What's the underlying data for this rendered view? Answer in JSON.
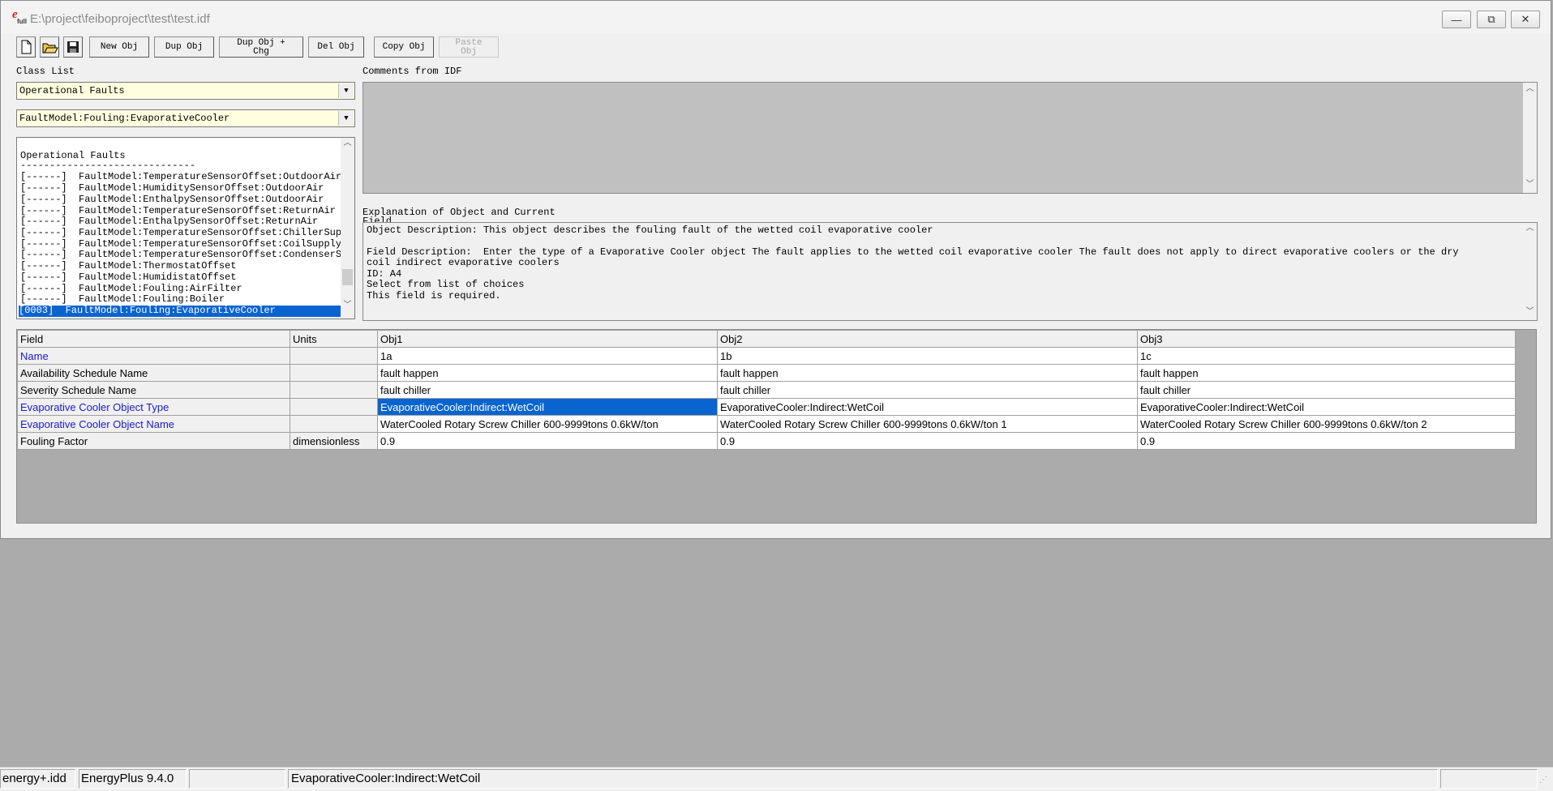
{
  "window": {
    "title": "E:\\project\\feiboproject\\test\\test.idf",
    "buttons": {
      "minimize_glyph": "▭",
      "maximize_glyph": "⧉",
      "close_glyph": "✕"
    }
  },
  "toolbar": {
    "new_obj": "New Obj",
    "dup_obj": "Dup Obj",
    "dup_obj_chg_line1": "Dup Obj +",
    "dup_obj_chg_line2": "Chg",
    "del_obj": "Del Obj",
    "copy_obj": "Copy Obj",
    "paste_obj_line1": "Paste",
    "paste_obj_line2": "Obj"
  },
  "left": {
    "class_list_label": "Class List",
    "group_dropdown": "Operational Faults",
    "class_dropdown": "FaultModel:Fouling:EvaporativeCooler",
    "list": {
      "header": "Operational Faults",
      "separator": "------------------------------",
      "items": [
        "[------]  FaultModel:TemperatureSensorOffset:OutdoorAir",
        "[------]  FaultModel:HumiditySensorOffset:OutdoorAir",
        "[------]  FaultModel:EnthalpySensorOffset:OutdoorAir",
        "[------]  FaultModel:TemperatureSensorOffset:ReturnAir",
        "[------]  FaultModel:EnthalpySensorOffset:ReturnAir",
        "[------]  FaultModel:TemperatureSensorOffset:ChillerSupplyWater",
        "[------]  FaultModel:TemperatureSensorOffset:CoilSupplyAir",
        "[------]  FaultModel:TemperatureSensorOffset:CondenserSupplyWater",
        "[------]  FaultModel:ThermostatOffset",
        "[------]  FaultModel:HumidistatOffset",
        "[------]  FaultModel:Fouling:AirFilter",
        "[------]  FaultModel:Fouling:Boiler"
      ],
      "selected": "[0003]  FaultModel:Fouling:EvaporativeCooler"
    }
  },
  "right": {
    "comments_label": "Comments from IDF",
    "explanation_label": "Explanation of Object and Current",
    "explanation_label_cut": "Field",
    "explanation_lines": [
      "Object Description: This object describes the fouling fault of the wetted coil evaporative cooler",
      "",
      "Field Description:  Enter the type of a Evaporative Cooler object The fault applies to the wetted coil evaporative cooler The fault does not apply to direct evaporative coolers or the dry",
      "coil indirect evaporative coolers",
      "ID: A4",
      "Select from list of choices",
      "This field is required."
    ]
  },
  "grid": {
    "headers": [
      "Field",
      "Units",
      "Obj1",
      "Obj2",
      "Obj3"
    ],
    "rows": [
      {
        "field": "Name",
        "units": "",
        "values": [
          "1a",
          "1b",
          "1c"
        ],
        "required": true
      },
      {
        "field": "Availability Schedule Name",
        "units": "",
        "values": [
          "fault happen",
          "fault happen",
          "fault happen"
        ],
        "required": false
      },
      {
        "field": "Severity Schedule Name",
        "units": "",
        "values": [
          "fault chiller",
          "fault chiller",
          "fault chiller"
        ],
        "required": false
      },
      {
        "field": "Evaporative Cooler Object Type",
        "units": "",
        "values": [
          "EvaporativeCooler:Indirect:WetCoil",
          "EvaporativeCooler:Indirect:WetCoil",
          "EvaporativeCooler:Indirect:WetCoil"
        ],
        "required": true
      },
      {
        "field": "Evaporative Cooler Object Name",
        "units": "",
        "values": [
          "WaterCooled Rotary Screw Chiller 600-9999tons 0.6kW/ton",
          "WaterCooled Rotary Screw Chiller 600-9999tons 0.6kW/ton 1",
          "WaterCooled Rotary Screw Chiller 600-9999tons 0.6kW/ton 2"
        ],
        "required": true
      },
      {
        "field": "Fouling Factor",
        "units": "dimensionless",
        "values": [
          "0.9",
          "0.9",
          "0.9"
        ],
        "required": false
      }
    ],
    "selected_cell": {
      "row": 3,
      "col": 0
    },
    "required_color": "#1a1ac8",
    "selection_color": "#0a64d0"
  },
  "statusbar": {
    "idd": "energy+.idd",
    "version": "EnergyPlus 9.4.0",
    "empty1": "",
    "current_value": "EvaporativeCooler:Indirect:WetCoil",
    "empty2": ""
  }
}
